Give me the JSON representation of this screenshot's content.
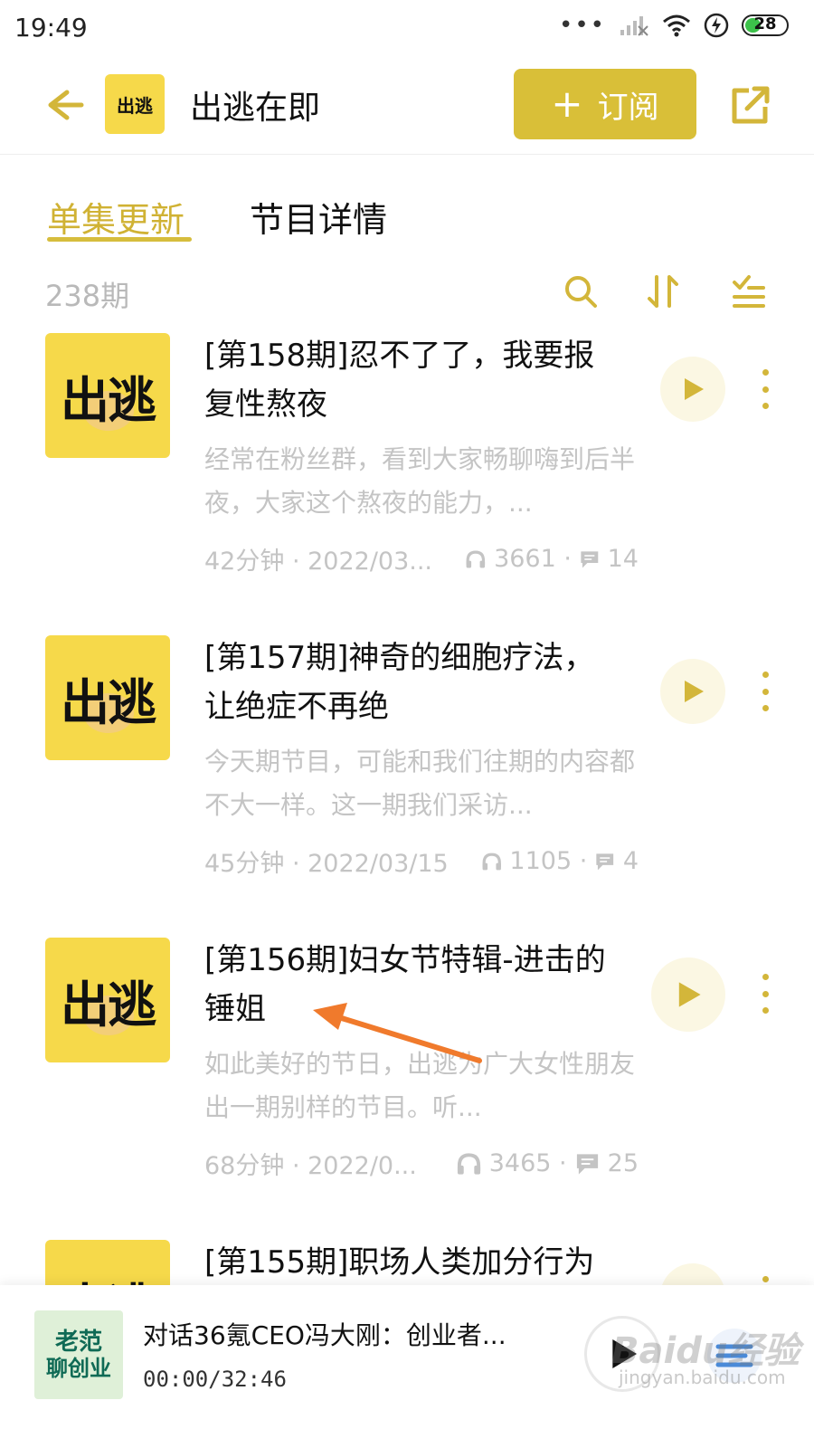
{
  "status_bar": {
    "time": "19:49",
    "battery": "28",
    "dots": "•••"
  },
  "header": {
    "podcast_logo_text": "出逃",
    "podcast_title": "出逃在即",
    "subscribe_label": "订阅",
    "subscribe_plus": "+"
  },
  "tabs": [
    {
      "label": "单集更新",
      "active": true
    },
    {
      "label": "节目详情",
      "active": false
    }
  ],
  "toolbar": {
    "episode_count": "238期"
  },
  "episodes": [
    {
      "cover_text": "出逃",
      "title": "[第158期]忍不了了，我要报复性熬夜",
      "description": "经常在粉丝群，看到大家畅聊嗨到后半夜，大家这个熬夜的能力，...",
      "duration_date": "42分钟 · 2022/03...",
      "plays": "3661",
      "comments": "14"
    },
    {
      "cover_text": "出逃",
      "title": "[第157期]神奇的细胞疗法，让绝症不再绝",
      "description": "今天期节目，可能和我们往期的内容都不大一样。这一期我们采访...",
      "duration_date": "45分钟 · 2022/03/15",
      "plays": "1105",
      "comments": "4"
    },
    {
      "cover_text": "出逃",
      "title": "[第156期]妇女节特辑-进击的锤姐",
      "description": "如此美好的节日，出逃为广大女性朋友出一期别样的节目。听...",
      "duration_date": "68分钟 · 2022/0...",
      "plays": "3465",
      "comments": "25"
    },
    {
      "cover_text": "出逃",
      "title": "[第155期]职场人类加分行为",
      "description": "",
      "duration_date": "",
      "plays": "",
      "comments": ""
    }
  ],
  "player": {
    "cover_line1": "老范",
    "cover_line2": "聊创业",
    "title": "对话36氪CEO冯大刚：创业者...",
    "time": "00:00/32:46"
  },
  "watermark": {
    "text": "Baidu经验",
    "sub": "jingyan.baidu.com"
  },
  "colors": {
    "accent": "#d9bf38",
    "cover_yellow": "#f6d94a",
    "muted_text": "#c4c4c4",
    "annotation": "#f07a2c"
  }
}
